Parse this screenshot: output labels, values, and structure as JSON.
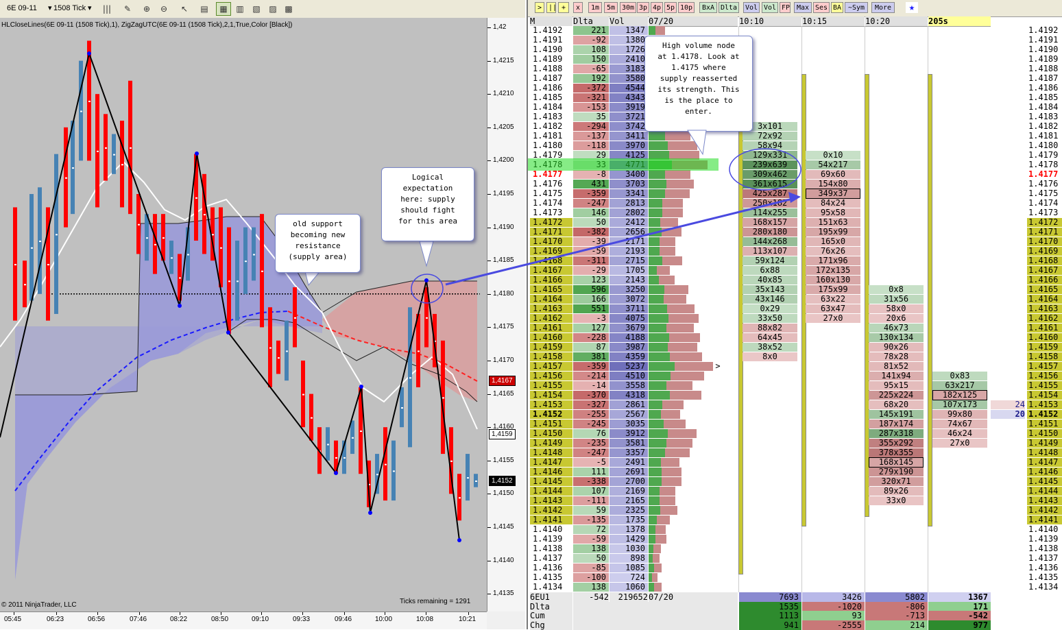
{
  "chart": {
    "toolbar": {
      "instrument": "6E 09-11",
      "interval": "1508 Tick"
    },
    "indicator_label": "HLCloseLines(6E 09-11 (1508 Tick),1), ZigZagUTC(6E 09-11 (1508 Tick),2,1,True,Color [Black])",
    "copyright": "© 2011 NinjaTrader, LLC",
    "ticks_remaining": "Ticks remaining = 1291",
    "price_ticks": [
      "1,42",
      "1,4215",
      "1,4210",
      "1,4205",
      "1,4200",
      "1,4195",
      "1,4190",
      "1,4185",
      "1,4180",
      "1,4175",
      "1,4170",
      "1,4165",
      "1,4160",
      "1,4155",
      "1,4150",
      "1,4145",
      "1,4140",
      "1,4135"
    ],
    "time_ticks": [
      "05:45",
      "06:23",
      "06:56",
      "07:46",
      "08:22",
      "08:50",
      "09:10",
      "09:33",
      "09:46",
      "10:00",
      "10:08",
      "10:21"
    ],
    "price_badges": {
      "current": "1,4167",
      "close": "1,4159",
      "last": "1,4152"
    },
    "colors": {
      "up_bar": "#4682b4",
      "down_bar": "#ff0000",
      "cloud_blue": "#9a9ad8",
      "cloud_red": "#d8a0a0"
    },
    "callouts": {
      "support": "old support\nbecoming new\nresistance\n(supply area)",
      "logical": "Logical\nexpectation\nhere: supply\nshould fight\nfor this area",
      "hvn": "High volume node\nat 1.4178. Look at\n1.4175 where\nsupply reasserted\nits strength. This\nis the place to\nenter."
    }
  },
  "ladder": {
    "toolbar_buttons": [
      ">",
      "||",
      "+",
      "x",
      "1m",
      "5m",
      "30m",
      "3p",
      "4p",
      "5p",
      "10p",
      "BxA",
      "Dlta",
      "Vol",
      "Vol",
      "FP",
      "Max",
      "Ses",
      "BA",
      "~Sym",
      "More"
    ],
    "headers": {
      "m": "M",
      "delta": "Dlta",
      "vol": "Vol",
      "date": "07/20",
      "t1": "10:10",
      "t2": "10:15",
      "t3": "10:20",
      "t4": "205s"
    },
    "rows": [
      {
        "p": "1.4192",
        "d": "221",
        "v": "1347"
      },
      {
        "p": "1.4191",
        "d": "-92",
        "v": "1380"
      },
      {
        "p": "1.4190",
        "d": "108",
        "v": "1726"
      },
      {
        "p": "1.4189",
        "d": "150",
        "v": "2410"
      },
      {
        "p": "1.4188",
        "d": "-65",
        "v": "3183"
      },
      {
        "p": "1.4187",
        "d": "192",
        "v": "3580"
      },
      {
        "p": "1.4186",
        "d": "-372",
        "v": "4544"
      },
      {
        "p": "1.4185",
        "d": "-321",
        "v": "4343"
      },
      {
        "p": "1.4184",
        "d": "-153",
        "v": "3919"
      },
      {
        "p": "1.4183",
        "d": "35",
        "v": "3721"
      },
      {
        "p": "1.4182",
        "d": "-294",
        "v": "3742"
      },
      {
        "p": "1.4181",
        "d": "-137",
        "v": "3411"
      },
      {
        "p": "1.4180",
        "d": "-118",
        "v": "3970"
      },
      {
        "p": "1.4179",
        "d": "29",
        "v": "4125"
      },
      {
        "p": "1.4178",
        "d": "33",
        "v": "4771"
      },
      {
        "p": "1.4177",
        "d": "-8",
        "v": "3400"
      },
      {
        "p": "1.4176",
        "d": "431",
        "v": "3703"
      },
      {
        "p": "1.4175",
        "d": "-359",
        "v": "3341"
      },
      {
        "p": "1.4174",
        "d": "-247",
        "v": "2813"
      },
      {
        "p": "1.4173",
        "d": "146",
        "v": "2802"
      },
      {
        "p": "1.4172",
        "d": "50",
        "v": "2412"
      },
      {
        "p": "1.4171",
        "d": "-382",
        "v": "2656"
      },
      {
        "p": "1.4170",
        "d": "-39",
        "v": "2171"
      },
      {
        "p": "1.4169",
        "d": "-59",
        "v": "2193"
      },
      {
        "p": "1.4168",
        "d": "-311",
        "v": "2715"
      },
      {
        "p": "1.4167",
        "d": "-29",
        "v": "1705"
      },
      {
        "p": "1.4166",
        "d": "123",
        "v": "2143"
      },
      {
        "p": "1.4165",
        "d": "596",
        "v": "3250"
      },
      {
        "p": "1.4164",
        "d": "166",
        "v": "3072"
      },
      {
        "p": "1.4163",
        "d": "551",
        "v": "3711"
      },
      {
        "p": "1.4162",
        "d": "-3",
        "v": "4075"
      },
      {
        "p": "1.4161",
        "d": "127",
        "v": "3679"
      },
      {
        "p": "1.4160",
        "d": "-228",
        "v": "4188"
      },
      {
        "p": "1.4159",
        "d": "87",
        "v": "3987"
      },
      {
        "p": "1.4158",
        "d": "381",
        "v": "4359"
      },
      {
        "p": "1.4157",
        "d": "-359",
        "v": "5237"
      },
      {
        "p": "1.4156",
        "d": "-214",
        "v": "4510"
      },
      {
        "p": "1.4155",
        "d": "-14",
        "v": "3558"
      },
      {
        "p": "1.4154",
        "d": "-370",
        "v": "4318"
      },
      {
        "p": "1.4153",
        "d": "-327",
        "v": "2861"
      },
      {
        "p": "1.4152",
        "d": "-255",
        "v": "2567"
      },
      {
        "p": "1.4151",
        "d": "-245",
        "v": "3035"
      },
      {
        "p": "1.4150",
        "d": "76",
        "v": "3912"
      },
      {
        "p": "1.4149",
        "d": "-235",
        "v": "3581"
      },
      {
        "p": "1.4148",
        "d": "-247",
        "v": "3357"
      },
      {
        "p": "1.4147",
        "d": "-5",
        "v": "2491"
      },
      {
        "p": "1.4146",
        "d": "111",
        "v": "2691"
      },
      {
        "p": "1.4145",
        "d": "-338",
        "v": "2700"
      },
      {
        "p": "1.4144",
        "d": "107",
        "v": "2169"
      },
      {
        "p": "1.4143",
        "d": "-111",
        "v": "2165"
      },
      {
        "p": "1.4142",
        "d": "59",
        "v": "2325"
      },
      {
        "p": "1.4141",
        "d": "-135",
        "v": "1735"
      },
      {
        "p": "1.4140",
        "d": "72",
        "v": "1378"
      },
      {
        "p": "1.4139",
        "d": "-59",
        "v": "1429"
      },
      {
        "p": "1.4138",
        "d": "138",
        "v": "1030"
      },
      {
        "p": "1.4137",
        "d": "50",
        "v": "898"
      },
      {
        "p": "1.4136",
        "d": "-85",
        "v": "1085"
      },
      {
        "p": "1.4135",
        "d": "-100",
        "v": "724"
      },
      {
        "p": "1.4134",
        "d": "138",
        "v": "1060"
      }
    ],
    "footprints": {
      "c1": {
        "start": "1.4182",
        "cells": [
          "3x101",
          "72x92",
          "58x94",
          "129x331",
          "239x639",
          "309x462",
          "361x615",
          "425x287",
          "250x182",
          "114x255",
          "168x157",
          "280x180",
          "144x268",
          "113x107",
          "59x124",
          "6x88",
          "40x85",
          "35x143",
          "43x146",
          "0x29",
          "33x50",
          "88x82",
          "64x45",
          "38x52",
          "8x0"
        ]
      },
      "c2": {
        "start": "1.4179",
        "cells": [
          "0x10",
          "54x217",
          "69x60",
          "154x80",
          "349x37",
          "84x24",
          "95x58",
          "151x63",
          "195x99",
          "165x0",
          "76x26",
          "171x96",
          "172x135",
          "160x130",
          "175x99",
          "63x22",
          "63x47",
          "27x0"
        ]
      },
      "c3": {
        "start": "1.4165",
        "cells": [
          "0x8",
          "31x56",
          "58x0",
          "20x6",
          "46x73",
          "130x134",
          "90x26",
          "78x28",
          "81x52",
          "141x94",
          "95x15",
          "225x224",
          "68x20",
          "145x191",
          "187x174",
          "287x318",
          "355x292",
          "378x355",
          "168x145",
          "279x190",
          "320x71",
          "89x26",
          "33x0"
        ]
      },
      "c4": {
        "start": "1.4156",
        "cells": [
          "0x83",
          "63x217",
          "182x125",
          "107x173",
          "99x80",
          "74x67",
          "46x24",
          "27x0"
        ]
      }
    },
    "side_orders": {
      "a": "24",
      "b": "20"
    },
    "footer": {
      "row1": {
        "label": "6EU1",
        "delta": "-542",
        "vol": "219652",
        "date": "07/20",
        "c1": "7693",
        "c2": "3426",
        "c3": "5802",
        "c4": "1367"
      },
      "row2": {
        "label": "Dlta",
        "c1": "1535",
        "c2": "-1020",
        "c3": "-806",
        "c4": "171"
      },
      "row3": {
        "label": "Cum",
        "c1": "1113",
        "c2": "93",
        "c3": "-713",
        "c4": "-542"
      },
      "row4": {
        "label": "Chg",
        "c1": "941",
        "c2": "-2555",
        "c3": "214",
        "c4": "977"
      }
    }
  }
}
